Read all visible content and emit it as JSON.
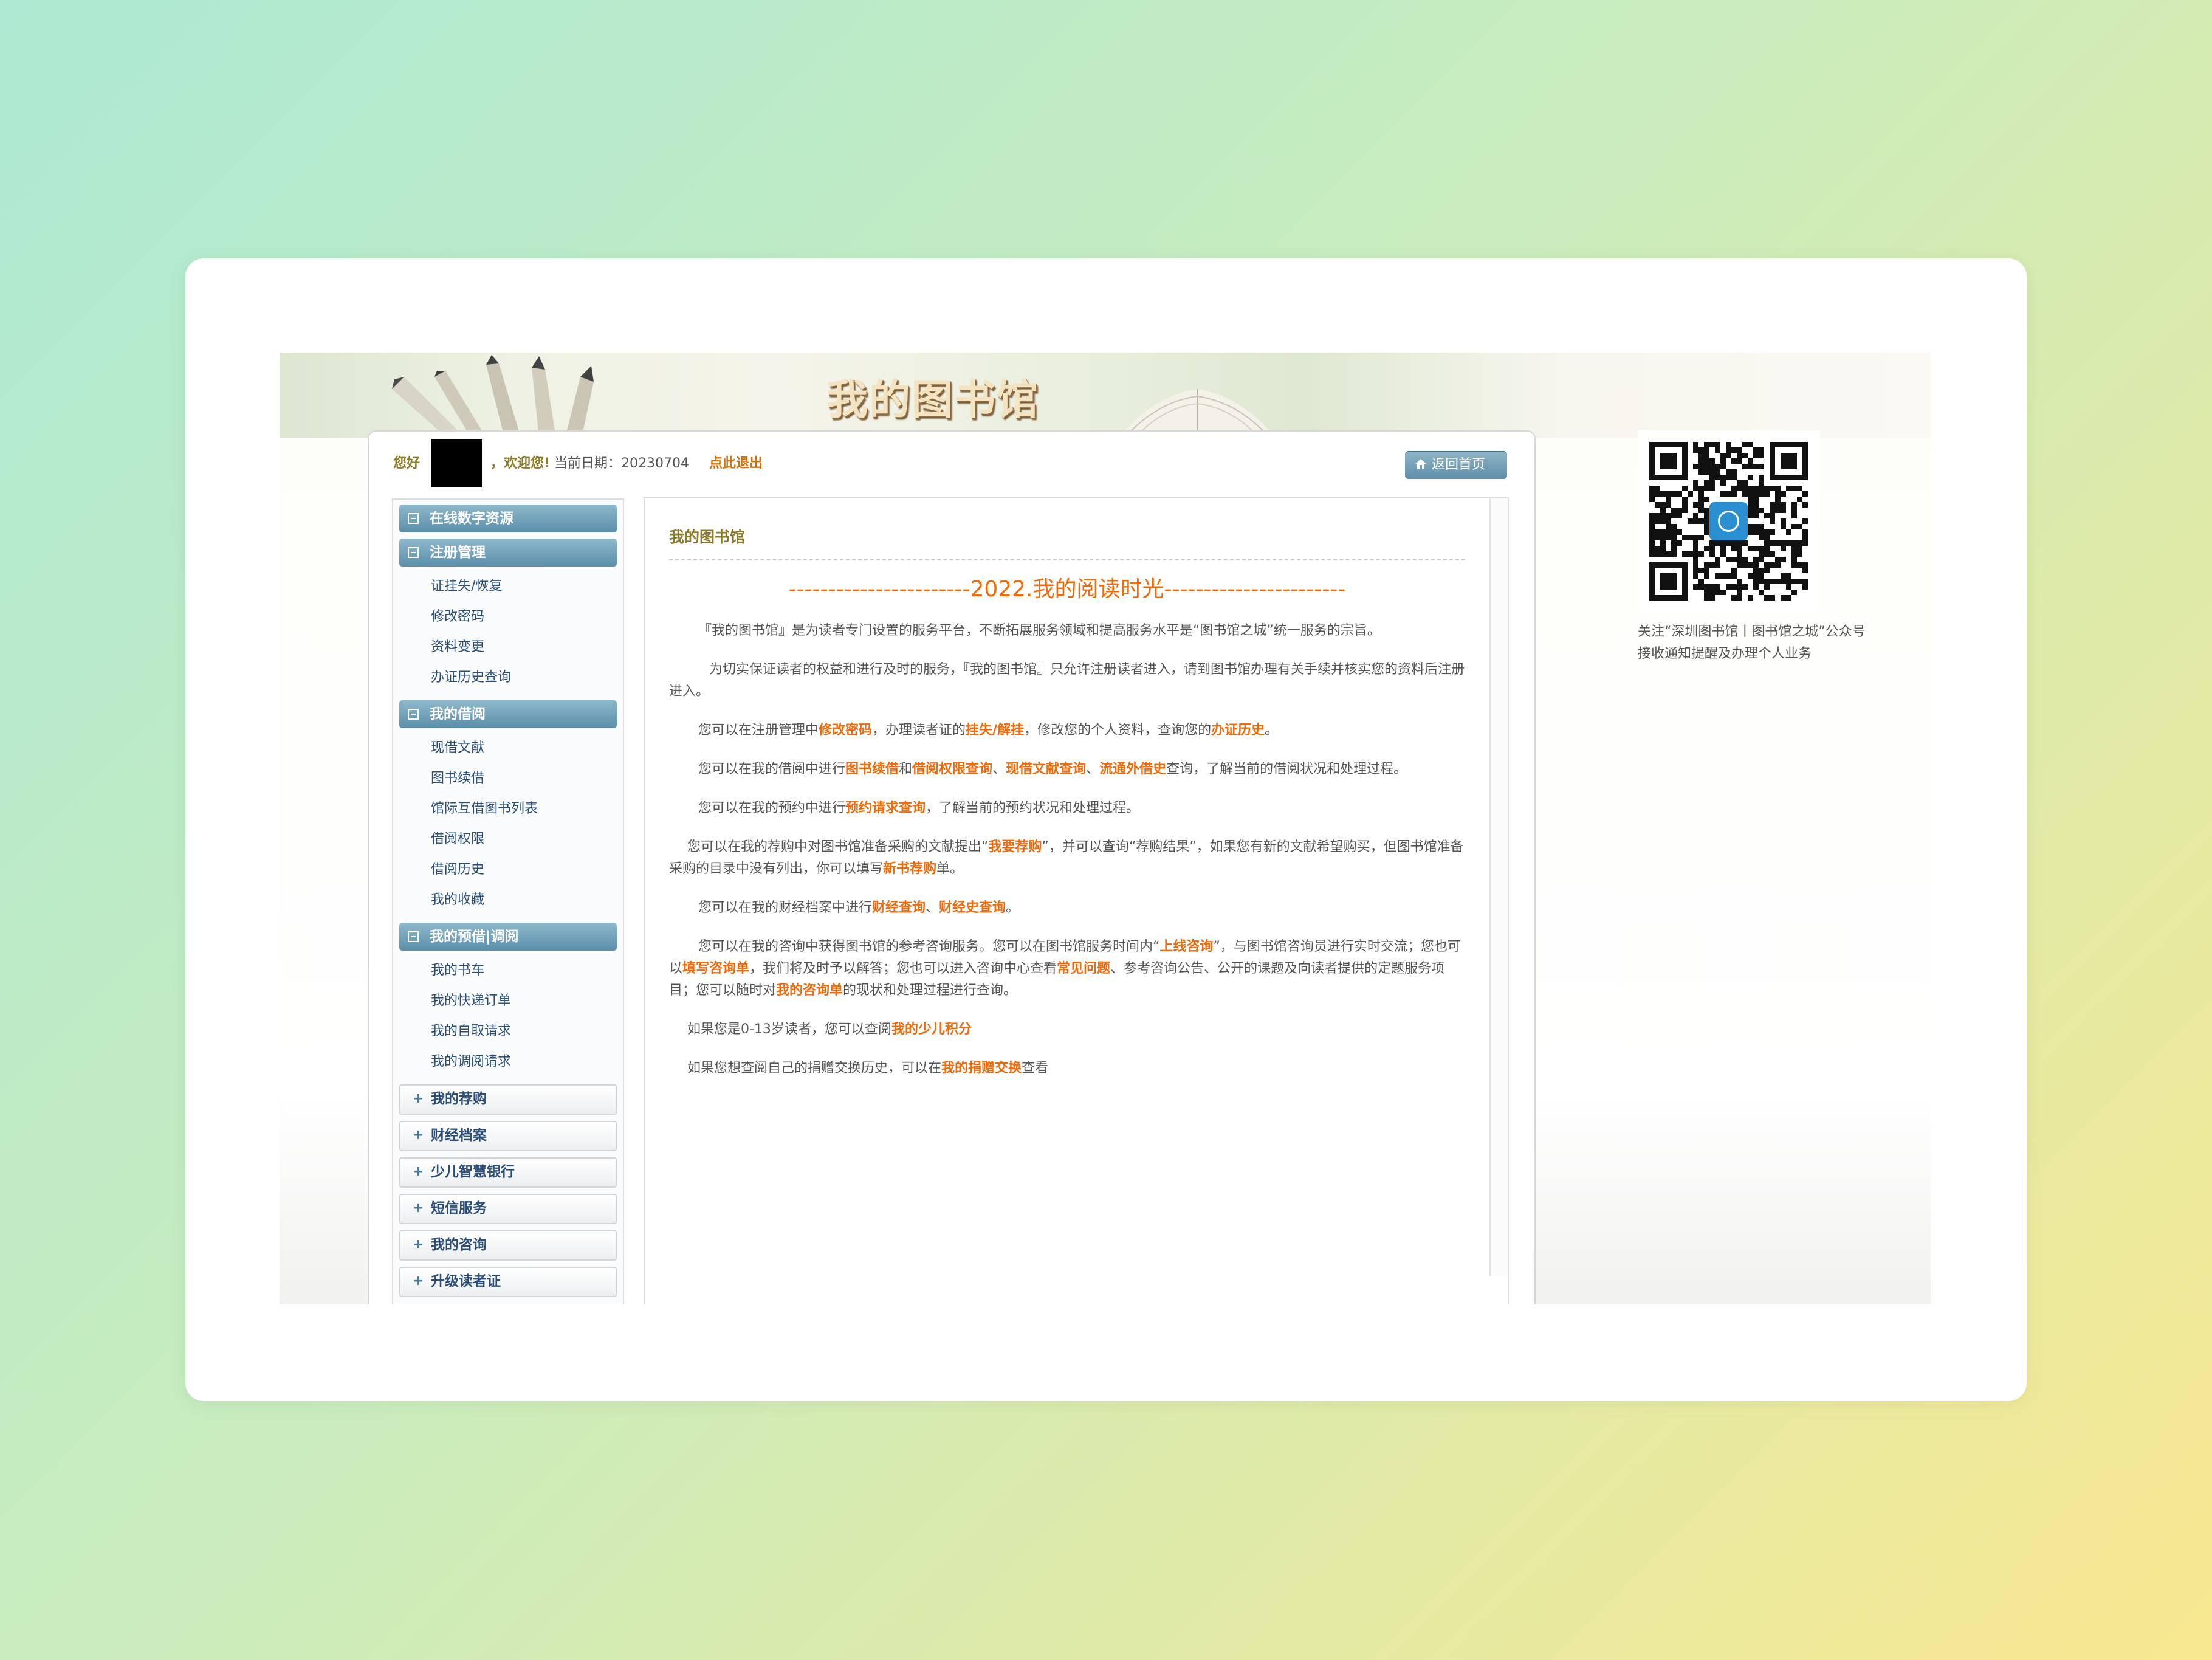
{
  "banner": {
    "title": "我的图书馆"
  },
  "topbar": {
    "hello": "您好",
    "welcome": "，欢迎您!",
    "date_label": "当前日期：",
    "date_value": "20230704",
    "logout": "点此退出",
    "home_button": "返回首页"
  },
  "sidebar": {
    "sections": [
      {
        "label": "在线数字资源",
        "items": []
      },
      {
        "label": "注册管理",
        "items": [
          "证挂失/恢复",
          "修改密码",
          "资料变更",
          "办证历史查询"
        ]
      },
      {
        "label": "我的借阅",
        "items": [
          "现借文献",
          "图书续借",
          "馆际互借图书列表",
          "借阅权限",
          "借阅历史",
          "我的收藏"
        ]
      },
      {
        "label": "我的预借|调阅",
        "items": [
          "我的书车",
          "我的快递订单",
          "我的自取请求",
          "我的调阅请求"
        ]
      }
    ],
    "collapsed": [
      "我的荐购",
      "财经档案",
      "少儿智慧银行",
      "短信服务",
      "我的咨询",
      "升级读者证"
    ]
  },
  "content": {
    "title": "我的图书馆",
    "headline": "-----------------------2022.我的阅读时光-----------------------",
    "p1": "『我的图书馆』是为读者专门设置的服务平台，不断拓展服务领域和提高服务水平是“图书馆之城”统一服务的宗旨。",
    "p2": "为切实保证读者的权益和进行及时的服务，『我的图书馆』只允许注册读者进入，请到图书馆办理有关手续并核实您的资料后注册进入。",
    "p3": {
      "a": "您可以在注册管理中",
      "b": "修改密码",
      "c": "，办理读者证的",
      "d": "挂失/解挂",
      "e": "，修改您的个人资料，查询您的",
      "f": "办证历史",
      "g": "。"
    },
    "p4": {
      "a": "您可以在我的借阅中进行",
      "b": "图书续借",
      "c": "和",
      "d": "借阅权限查询",
      "e": "、",
      "f": "现借文献查询",
      "g": "、",
      "h": "流通外借史",
      "i": "查询，了解当前的借阅状况和处理过程。"
    },
    "p5": {
      "a": "您可以在我的预约中进行",
      "b": "预约请求查询",
      "c": "，了解当前的预约状况和处理过程。"
    },
    "p6": {
      "a": "您可以在我的荐购中对图书馆准备采购的文献提出“",
      "b": "我要荐购",
      "c": "”，并可以查询“荐购结果”，如果您有新的文献希望购买，但图书馆准备采购的目录中没有列出，你可以填写",
      "d": "新书荐购",
      "e": "单。"
    },
    "p7": {
      "a": "您可以在我的财经档案中进行",
      "b": "财经查询",
      "c": "、",
      "d": "财经史查询",
      "e": "。"
    },
    "p8": {
      "a": "您可以在我的咨询中获得图书馆的参考咨询服务。您可以在图书馆服务时间内“",
      "b": "上线咨询",
      "c": "”，与图书馆咨询员进行实时交流；您也可以",
      "d": "填写咨询单",
      "e": "，我们将及时予以解答；您也可以进入咨询中心查看",
      "f": "常见问题",
      "g": "、参考咨询公告、公开的课题及向读者提供的定题服务项目；您可以随时对",
      "h": "我的咨询单",
      "i": "的现状和处理过程进行查询。"
    },
    "p9": {
      "a": "如果您是0-13岁读者，您可以查阅",
      "b": "我的少儿积分"
    },
    "p10": {
      "a": "如果您想查阅自己的捐赠交换历史，可以在",
      "b": "我的捐赠交换",
      "c": "查看"
    }
  },
  "qr": {
    "caption_line1": "关注“深圳图书馆丨图书馆之城”公众号",
    "caption_line2": "接收通知提醒及办理个人业务"
  },
  "colors": {
    "accent": "#ee6a0a",
    "nav_blue": "#5a8ea9",
    "olive_text": "#8a7a2a",
    "link_blue": "#2b4e78"
  },
  "icons": [
    "pencils-illustration",
    "open-book-illustration",
    "home-icon",
    "collapse-minus-icon",
    "expand-plus-icon",
    "qr-code"
  ]
}
